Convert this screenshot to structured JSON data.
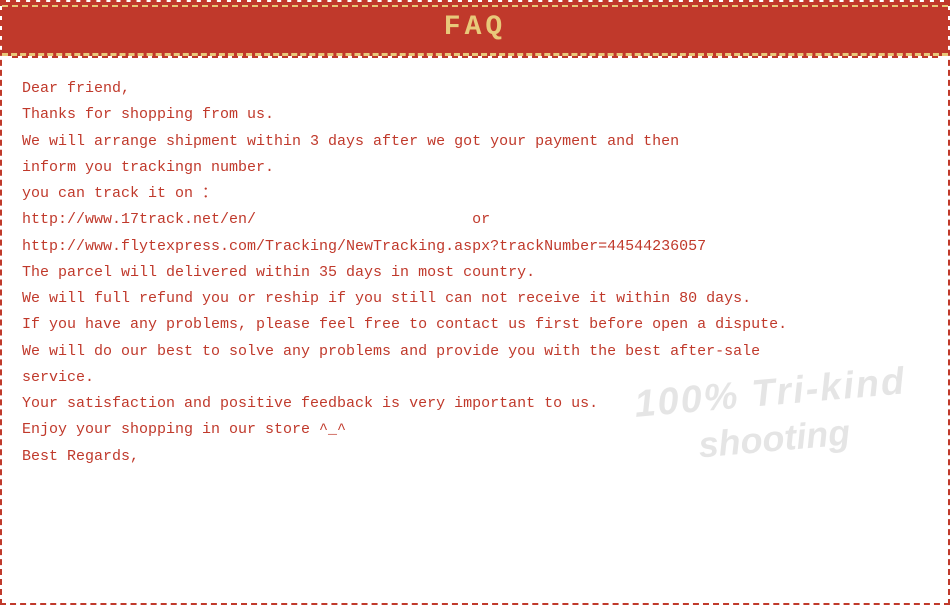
{
  "header": {
    "title": "FAQ"
  },
  "content": {
    "lines": [
      "Dear friend,",
      "Thanks for shopping from us.",
      "We will arrange shipment within 3 days after we got your payment and then",
      "inform you trackingn number.",
      "you can track it on ：",
      "http://www.17track.net/en/                        or",
      "http://www.flytexpress.com/Tracking/NewTracking.aspx?trackNumber=44544236057",
      "The parcel will delivered within 35 days in most country.",
      "We will full refund you or reship if you still can not receive it within 80 days.",
      "If you have any problems, please feel free to contact us first before open a dispute.",
      "We will do our best to solve any problems and provide you with the best after-sale",
      "service.",
      "Your satisfaction and positive feedback is very important to us.",
      "Enjoy your shopping in our store ^_^",
      "Best Regards,"
    ]
  },
  "watermark": {
    "line1": "100% Tri-kind",
    "line2": "shooting"
  }
}
